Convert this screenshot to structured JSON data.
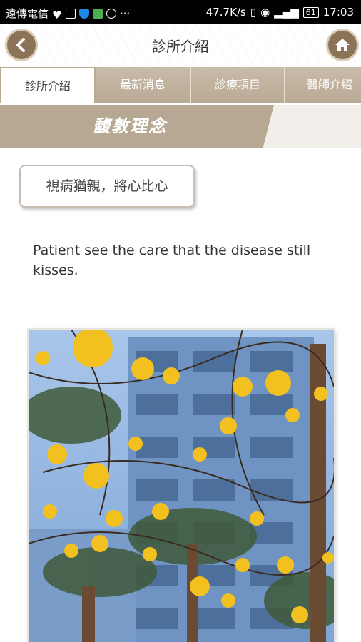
{
  "status_bar": {
    "carrier": "遠傳電信",
    "speed": "47.7K/s",
    "battery": "61",
    "time": "17:03",
    "dots": "···"
  },
  "header": {
    "title": "診所介紹",
    "back_icon": "chevron-left-icon",
    "home_icon": "home-icon"
  },
  "tabs": [
    {
      "label": "診所介紹",
      "active": true
    },
    {
      "label": "最新消息",
      "active": false
    },
    {
      "label": "診療項目",
      "active": false
    },
    {
      "label": "醫師介紹",
      "active": false
    }
  ],
  "section": {
    "title": "馥敦理念",
    "motto": "視病猶親，將心比心",
    "description": "Patient see the care that the disease still kisses."
  },
  "colors": {
    "accent": "#8a7356",
    "tab_bg": "#c8bba8",
    "banner": "#b6a892"
  }
}
